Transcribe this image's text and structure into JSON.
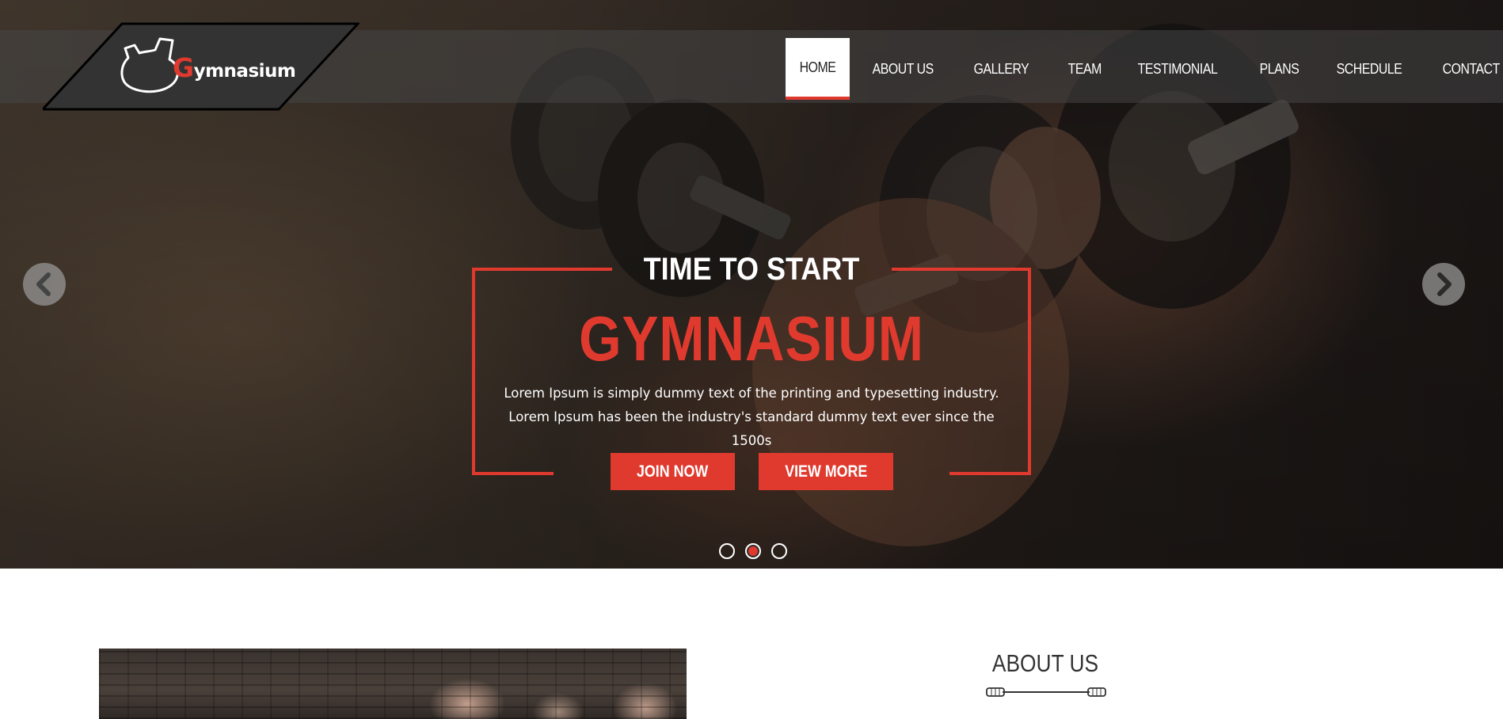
{
  "brand": {
    "logo_initial": "G",
    "logo_rest": "ymnasium"
  },
  "nav": {
    "items": [
      {
        "label": "HOME",
        "active": true
      },
      {
        "label": "ABOUT US"
      },
      {
        "label": "GALLERY"
      },
      {
        "label": "TEAM"
      },
      {
        "label": "TESTIMONIAL"
      },
      {
        "label": "PLANS"
      },
      {
        "label": "SCHEDULE"
      },
      {
        "label": "CONTACT"
      }
    ]
  },
  "hero": {
    "kicker": "TIME TO START",
    "headline": "GYMNASIUM",
    "description": "Lorem Ipsum is simply dummy text of the printing and typesetting industry. Lorem Ipsum has been the industry's standard dummy text ever since the 1500s",
    "buttons": {
      "join": "JOIN NOW",
      "more": "VIEW MORE"
    },
    "slide_count": 3,
    "active_slide": 2
  },
  "about": {
    "title": "ABOUT US"
  },
  "colors": {
    "accent": "#e03a2f",
    "dark": "#222222"
  },
  "icons": [
    "flexed-arm-logo-icon",
    "chevron-left-icon",
    "chevron-right-icon",
    "barbell-divider-icon"
  ]
}
